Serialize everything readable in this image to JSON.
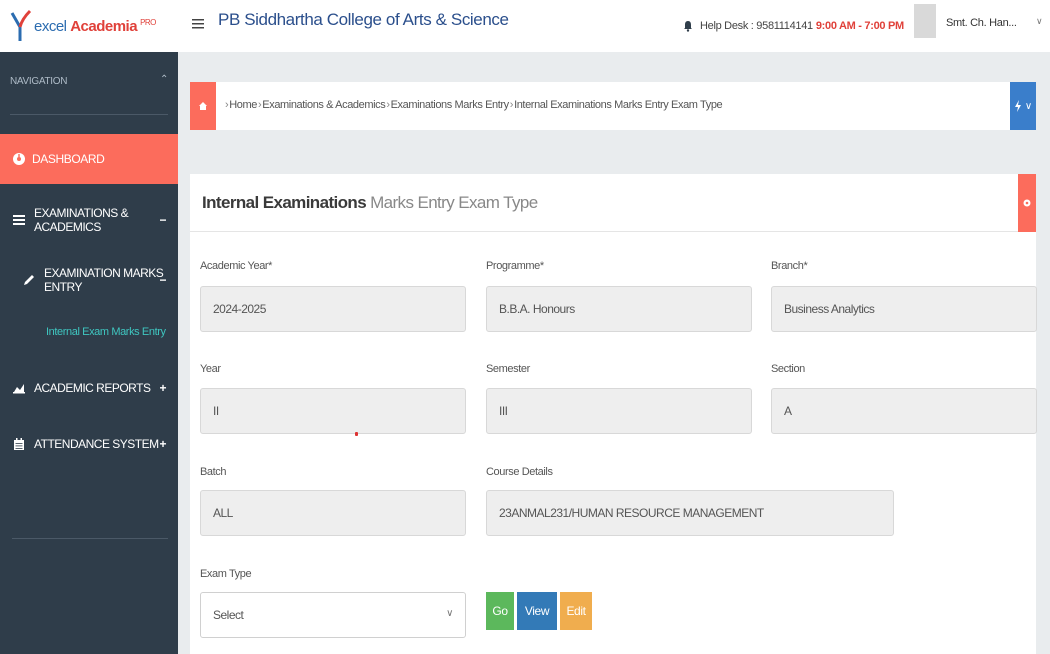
{
  "topbar": {
    "logo_text": "excel ",
    "logo_brand": "Academia",
    "logo_sup": "PRO",
    "college_name": "PB Siddhartha College of Arts & Science",
    "helpdesk_text": "Help Desk : 9581114141",
    "helpdesk_hours": "9:00 AM - 7:00 PM",
    "username": "Smt. Ch. Han..."
  },
  "sidebar": {
    "nav_title": "NAVIGATION",
    "dashboard": "DASHBOARD",
    "exam_academics": "EXAMINATIONS & ACADEMICS",
    "exam_marks_entry": "EXAMINATION MARKS ENTRY",
    "internal_exam_link": "Internal Exam Marks Entry",
    "academic_reports": "ACADEMIC REPORTS",
    "attendance_system": "ATTENDANCE SYSTEM",
    "toggle_minus": "−",
    "toggle_plus": "+"
  },
  "breadcrumb": {
    "items": [
      "Home",
      "Examinations & Academics",
      "Examinations Marks Entry",
      "Internal Examinations Marks Entry Exam Type"
    ]
  },
  "panel": {
    "title_bold": "Internal Examinations",
    "title_rest": "Marks Entry Exam Type"
  },
  "form": {
    "academic_year_label": "Academic Year*",
    "academic_year_value": "2024-2025",
    "programme_label": "Programme*",
    "programme_value": "B.B.A. Honours",
    "branch_label": "Branch*",
    "branch_value": "Business Analytics",
    "year_label": "Year",
    "year_value": "II",
    "semester_label": "Semester",
    "semester_value": "III",
    "section_label": "Section",
    "section_value": "A",
    "batch_label": "Batch",
    "batch_value": "ALL",
    "course_label": "Course Details",
    "course_value": "23ANMAL231/HUMAN RESOURCE MANAGEMENT",
    "exam_type_label": "Exam Type",
    "exam_type_value": "Select"
  },
  "buttons": {
    "go": "Go",
    "view": "View",
    "edit": "Edit"
  },
  "colors": {
    "accent": "#fc6c5c",
    "sidebar": "#2f3d4a",
    "link": "#3fc6c0",
    "go": "#5cb85c",
    "view": "#337ab7",
    "edit": "#f0ad4e"
  }
}
